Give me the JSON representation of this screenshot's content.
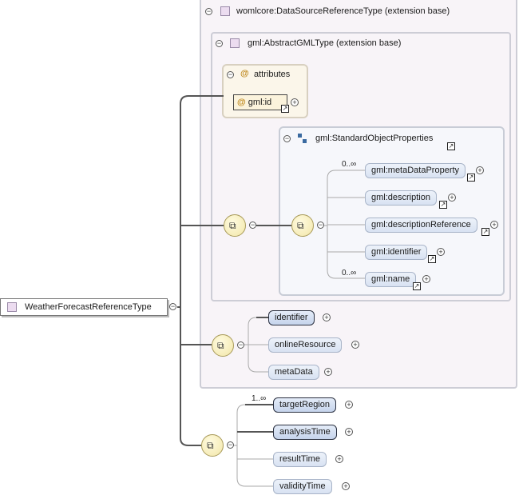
{
  "root": {
    "label": "WeatherForecastReferenceType"
  },
  "outer_ext": {
    "label": "womlcore:DataSourceReferenceType (extension base)"
  },
  "inner_ext": {
    "label": "gml:AbstractGMLType (extension base)"
  },
  "attributes": {
    "label": "attributes",
    "items": [
      "gml:id"
    ]
  },
  "standard_props": {
    "label": "gml:StandardObjectProperties",
    "items": [
      {
        "label": "gml:metaDataProperty",
        "card": "0..∞"
      },
      {
        "label": "gml:description",
        "card": ""
      },
      {
        "label": "gml:descriptionReference",
        "card": ""
      },
      {
        "label": "gml:identifier",
        "card": ""
      },
      {
        "label": "gml:name",
        "card": "0..∞"
      }
    ]
  },
  "ext_sequence": {
    "items": [
      "identifier",
      "onlineResource",
      "metaData"
    ]
  },
  "own_sequence": {
    "items": [
      {
        "label": "targetRegion",
        "card": "1..∞"
      },
      {
        "label": "analysisTime",
        "card": ""
      },
      {
        "label": "resultTime",
        "card": ""
      },
      {
        "label": "validityTime",
        "card": ""
      }
    ]
  },
  "glyphs": {
    "collapse": "−",
    "expand": "+",
    "ref_arrow": "↗",
    "attr_at": "@"
  },
  "colors": {
    "element_fill": "#c6d4ec",
    "extension_bg": "#f8f4f8",
    "attribute_bg": "#fbf6ea",
    "sequence_fill": "#f2e6a8"
  }
}
